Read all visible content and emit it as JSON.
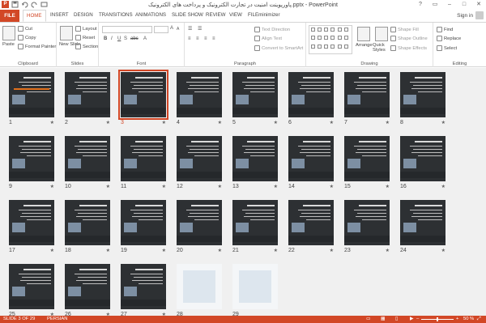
{
  "window": {
    "title": "پاورپوینت امنیت در تجارت الکترونیک و پرداخت های الکترونیک.pptx - PowerPoint",
    "controls": [
      "?",
      "▭",
      "–",
      "□",
      "✕"
    ]
  },
  "qat": {
    "app_icon": "powerpoint-logo",
    "app_letter": "P"
  },
  "tabs": [
    "FILE",
    "HOME",
    "INSERT",
    "DESIGN",
    "TRANSITIONS",
    "ANIMATIONS",
    "SLIDE SHOW",
    "REVIEW",
    "VIEW",
    "FILEminimizer"
  ],
  "active_tab": "HOME",
  "account": {
    "sign_in": "Sign in"
  },
  "ribbon": {
    "clipboard": {
      "label": "Clipboard",
      "paste": "Paste",
      "cut": "Cut",
      "copy": "Copy",
      "format_painter": "Format Painter"
    },
    "slides": {
      "label": "Slides",
      "new_slide": "New Slide",
      "layout": "Layout",
      "reset": "Reset",
      "section": "Section"
    },
    "font": {
      "label": "Font",
      "font_name": "",
      "font_size": ""
    },
    "paragraph": {
      "label": "Paragraph",
      "text_direction": "Text Direction",
      "align_text": "Align Text",
      "convert_smartart": "Convert to SmartArt"
    },
    "drawing": {
      "label": "Drawing",
      "arrange": "Arrange",
      "quick_styles": "Quick Styles",
      "shape_fill": "Shape Fill",
      "shape_outline": "Shape Outline",
      "shape_effects": "Shape Effects"
    },
    "editing": {
      "label": "Editing",
      "find": "Find",
      "replace": "Replace",
      "select": "Select"
    }
  },
  "slides": [
    {
      "number": "1"
    },
    {
      "number": "2"
    },
    {
      "number": "3"
    },
    {
      "number": "4"
    },
    {
      "number": "5"
    },
    {
      "number": "6"
    },
    {
      "number": "7"
    },
    {
      "number": "8"
    },
    {
      "number": "9"
    },
    {
      "number": "10"
    },
    {
      "number": "11"
    },
    {
      "number": "12"
    },
    {
      "number": "13"
    },
    {
      "number": "14"
    },
    {
      "number": "15"
    },
    {
      "number": "16"
    },
    {
      "number": "17"
    },
    {
      "number": "18"
    },
    {
      "number": "19"
    },
    {
      "number": "20"
    },
    {
      "number": "21"
    },
    {
      "number": "22"
    },
    {
      "number": "23"
    },
    {
      "number": "24"
    },
    {
      "number": "25"
    },
    {
      "number": "26"
    },
    {
      "number": "27"
    },
    {
      "number": "28"
    },
    {
      "number": "29"
    }
  ],
  "selected_slide": "3",
  "transition_marker": "★",
  "status": {
    "slide_count": "SLIDE 3 OF 29",
    "language": "PERSIAN",
    "zoom_out": "–",
    "zoom_in": "+",
    "zoom_level": "50 %"
  },
  "colors": {
    "accent": "#d24726"
  }
}
